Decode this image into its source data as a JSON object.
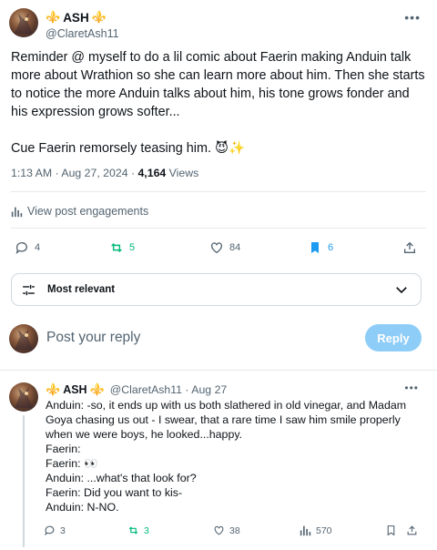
{
  "post": {
    "author_name": "ASH",
    "author_handle": "@ClaretAsh11",
    "fleur_left": "⚜️",
    "fleur_right": "⚜️",
    "paragraphs": [
      "Reminder @ myself to do a lil comic about Faerin making Anduin talk more about Wrathion so she can learn more about him. Then she starts to notice the more Anduin talks about him, his tone grows fonder and his expression grows softer...",
      "Cue Faerin remorsely teasing him. 😈✨"
    ],
    "time": "1:13 AM · Aug 27, 2024 · ",
    "views_count": "4,164",
    "views_label": " Views",
    "engagements_label": "View post engagements",
    "counts": {
      "replies": "4",
      "reposts": "5",
      "likes": "84",
      "bookmarks": "6"
    },
    "colors": {
      "repost_green": "#00ba7c",
      "bookmark_blue": "#1d9bf0"
    }
  },
  "sort": {
    "label": "Most relevant"
  },
  "compose": {
    "placeholder": "Post your reply",
    "reply_label": "Reply"
  },
  "comment": {
    "author_name": "ASH",
    "handle_date": "@ClaretAsh11 · Aug 27",
    "lines": [
      "Anduin: -so, it ends up with us both slathered in old vinegar, and Madam Goya chasing us out - I swear, that a rare time I saw him smile properly when we were boys, he looked...happy.",
      "Faerin:",
      "Faerin: 👀",
      "Anduin: ...what's that look for?",
      "Faerin: Did you want to kis-",
      "Anduin: N-NO."
    ],
    "counts": {
      "replies": "3",
      "reposts": "3",
      "likes": "38",
      "views": "570"
    }
  },
  "icons": [
    "more-icon",
    "analytics-icon",
    "reply-icon",
    "repost-icon",
    "like-icon",
    "bookmark-icon",
    "share-icon",
    "sort-icon",
    "chevron-down-icon"
  ]
}
